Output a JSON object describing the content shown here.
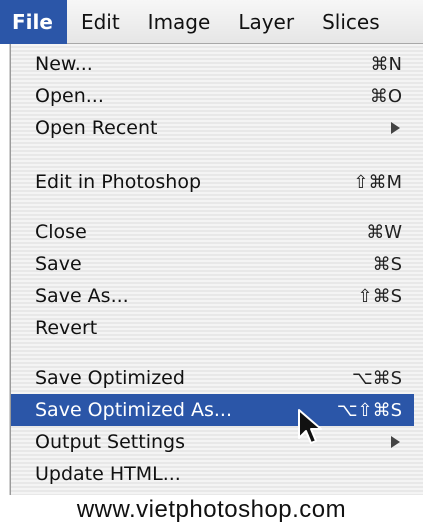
{
  "menubar": {
    "items": [
      {
        "label": "File",
        "active": true
      },
      {
        "label": "Edit",
        "active": false
      },
      {
        "label": "Image",
        "active": false
      },
      {
        "label": "Layer",
        "active": false
      },
      {
        "label": "Slices",
        "active": false
      }
    ]
  },
  "file_menu": {
    "items": [
      {
        "label": "New...",
        "shortcut": "⌘N",
        "submenu": false
      },
      {
        "label": "Open...",
        "shortcut": "⌘O",
        "submenu": false
      },
      {
        "label": "Open Recent",
        "shortcut": "",
        "submenu": true
      },
      {
        "label": "Edit in Photoshop",
        "shortcut": "⇧⌘M",
        "submenu": false
      },
      {
        "label": "Close",
        "shortcut": "⌘W",
        "submenu": false
      },
      {
        "label": "Save",
        "shortcut": "⌘S",
        "submenu": false
      },
      {
        "label": "Save As...",
        "shortcut": "⇧⌘S",
        "submenu": false
      },
      {
        "label": "Revert",
        "shortcut": "",
        "submenu": false
      },
      {
        "label": "Save Optimized",
        "shortcut": "⌥⌘S",
        "submenu": false
      },
      {
        "label": "Save Optimized As...",
        "shortcut": "⌥⇧⌘S",
        "submenu": false,
        "highlighted": true
      },
      {
        "label": "Output Settings",
        "shortcut": "",
        "submenu": true
      },
      {
        "label": "Update HTML...",
        "shortcut": "",
        "submenu": false
      }
    ]
  },
  "footer": {
    "text": "www.vietphotoshop.com"
  },
  "colors": {
    "highlight": "#2b56a8",
    "menu_background": "#efefef"
  }
}
